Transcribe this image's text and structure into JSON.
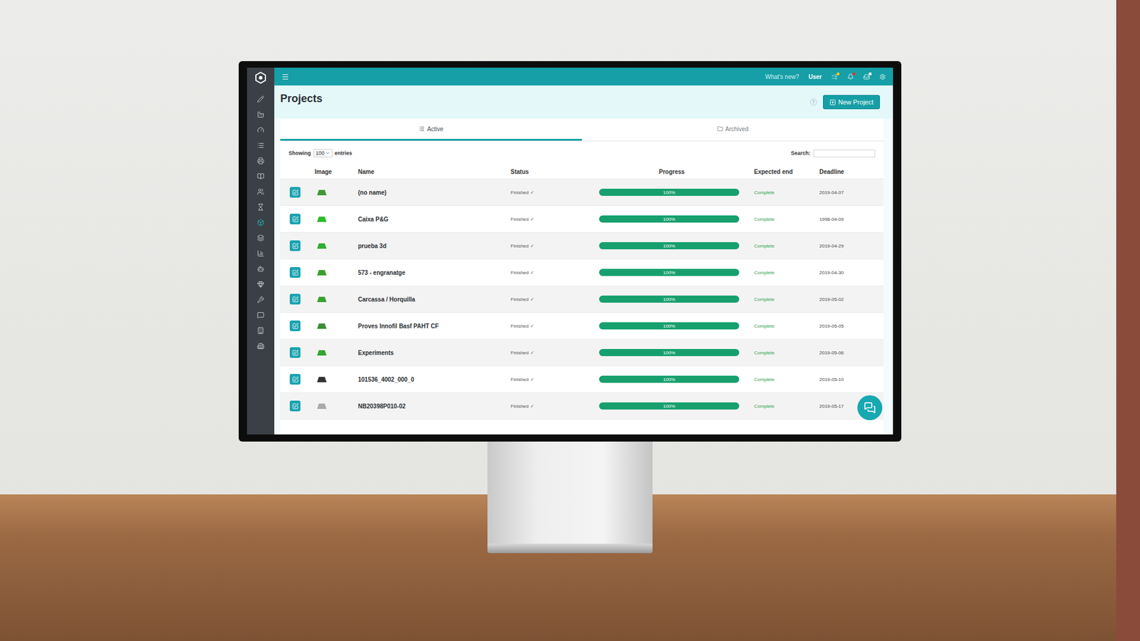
{
  "topbar": {
    "whats_new": "What's new?",
    "user": "User",
    "notifications": [
      {
        "color": "#f5c518"
      },
      {
        "color": "#e53935"
      },
      {
        "color": "#ffffff"
      }
    ]
  },
  "sidebar": {
    "items": [
      {
        "selected": false
      },
      {
        "selected": false
      },
      {
        "selected": false
      },
      {
        "selected": false
      },
      {
        "selected": false
      },
      {
        "selected": false
      },
      {
        "selected": false
      },
      {
        "selected": false
      },
      {
        "selected": true
      },
      {
        "selected": false
      },
      {
        "selected": false
      },
      {
        "selected": false
      },
      {
        "selected": false
      },
      {
        "selected": false
      },
      {
        "selected": false
      },
      {
        "selected": false
      },
      {
        "selected": false
      }
    ]
  },
  "page": {
    "title": "Projects",
    "help": "?",
    "new_button": "New Project"
  },
  "tabs": [
    {
      "label": "Active",
      "selected": true
    },
    {
      "label": "Archived",
      "selected": false
    }
  ],
  "length": {
    "label_before": "Showing",
    "value": "100",
    "label_after": "entries"
  },
  "search": {
    "label": "Search:",
    "value": ""
  },
  "table": {
    "columns": [
      "Image",
      "Name",
      "Status",
      "Progress",
      "Expected end",
      "Deadline"
    ],
    "rows": [
      {
        "name": "(no name)",
        "status": "Finished",
        "status_mark": "✓",
        "level": 1,
        "progress": "100%",
        "expected": "Complete",
        "deadline": "2019-04-07",
        "color": "#3d9a2e"
      },
      {
        "name": "Caixa P&G",
        "status": "Finished",
        "status_mark": "✓",
        "level": 1,
        "progress": "100%",
        "expected": "Complete",
        "deadline": "1998-04-09",
        "color": "#2dbb2d"
      },
      {
        "name": "prueba 3d",
        "status": "Finished",
        "status_mark": "✓",
        "level": 1,
        "progress": "100%",
        "expected": "Complete",
        "deadline": "2019-04-29",
        "color": "#2fae2f"
      },
      {
        "name": "573 - engranatge",
        "status": "Finished",
        "status_mark": "✓",
        "level": 1,
        "progress": "100%",
        "expected": "Complete",
        "deadline": "2019-04-30",
        "color": "#3a9e2c"
      },
      {
        "name": "Carcassa / Horquilla",
        "status": "Finished",
        "status_mark": "✓",
        "level": 1,
        "progress": "100%",
        "expected": "Complete",
        "deadline": "2019-05-02",
        "color": "#35a32f"
      },
      {
        "name": "Proves Innofil Basf PAHT CF",
        "status": "Finished",
        "status_mark": "✓",
        "level": 1,
        "progress": "100%",
        "expected": "Complete",
        "deadline": "2019-05-05",
        "color": "#3c8f34"
      },
      {
        "name": "Experiments",
        "status": "Finished",
        "status_mark": "✓",
        "level": 1,
        "progress": "100%",
        "expected": "Complete",
        "deadline": "2019-05-06",
        "color": "#2ea82e"
      },
      {
        "name": "101536_4002_000_0",
        "status": "Finished",
        "status_mark": "✓",
        "level": 1,
        "progress": "100%",
        "expected": "Complete",
        "deadline": "2019-05-10",
        "color": "#333333"
      },
      {
        "name": "NB20398P010-02",
        "status": "Finished",
        "status_mark": "✓",
        "level": 1,
        "progress": "100%",
        "expected": "Complete",
        "deadline": "2019-05-17",
        "color": "#aaaaaa"
      }
    ]
  }
}
